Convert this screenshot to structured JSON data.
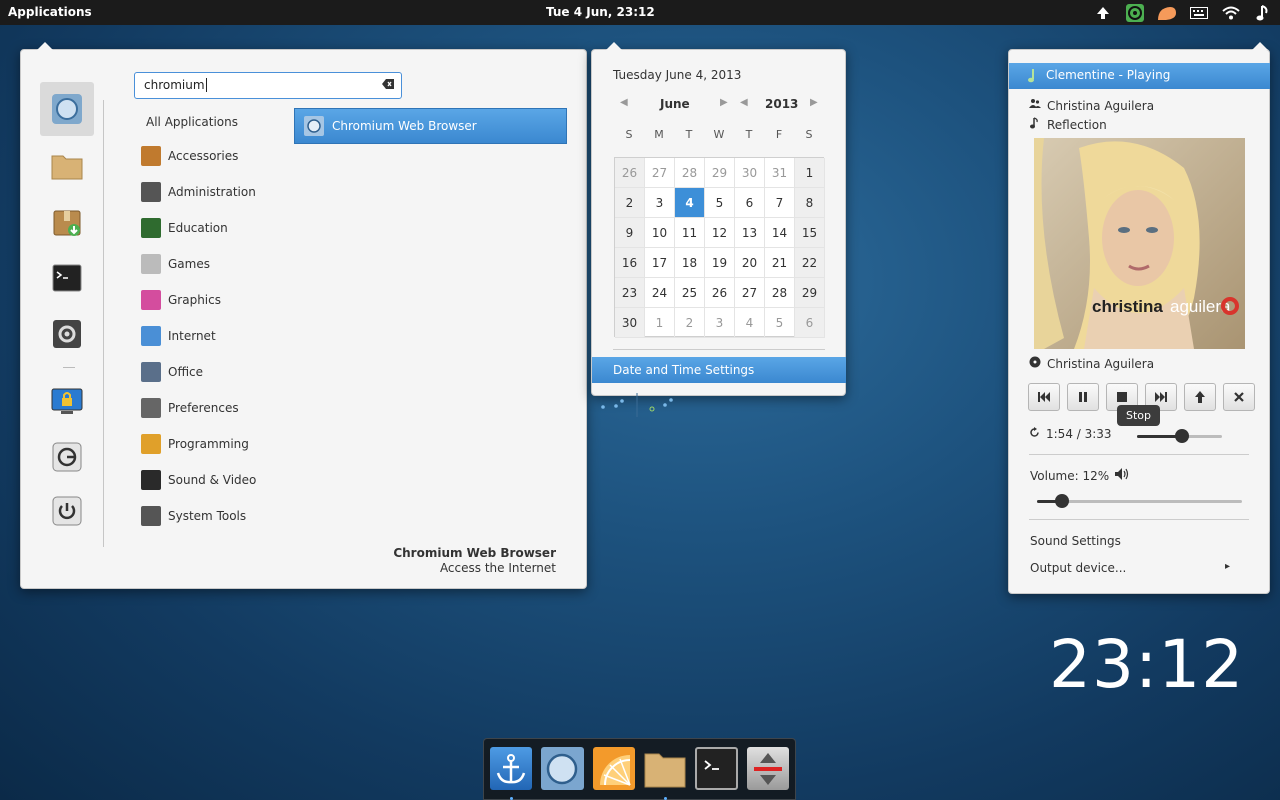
{
  "panel": {
    "applications_label": "Applications",
    "clock": "Tue  4 Jun, 23:12",
    "tray_icons": [
      "upload-icon",
      "clementine-icon",
      "power-plug-icon",
      "keyboard-icon",
      "wifi-icon",
      "sound-icon"
    ]
  },
  "appmenu": {
    "search_value": "chromium",
    "categories_header": "All Applications",
    "categories": [
      {
        "label": "Accessories",
        "icon": "calculator-icon",
        "color": "#c07a2e"
      },
      {
        "label": "Administration",
        "icon": "gear-icon",
        "color": "#555555"
      },
      {
        "label": "Education",
        "icon": "chalkboard-icon",
        "color": "#2f6b2f"
      },
      {
        "label": "Games",
        "icon": "gamepad-icon",
        "color": "#bbbbbb"
      },
      {
        "label": "Graphics",
        "icon": "palette-icon",
        "color": "#d44d9e"
      },
      {
        "label": "Internet",
        "icon": "globe-icon",
        "color": "#4a8fd6"
      },
      {
        "label": "Office",
        "icon": "chart-icon",
        "color": "#5a6f8a"
      },
      {
        "label": "Preferences",
        "icon": "sliders-icon",
        "color": "#666666"
      },
      {
        "label": "Programming",
        "icon": "construction-icon",
        "color": "#e0a02a"
      },
      {
        "label": "Sound & Video",
        "icon": "film-icon",
        "color": "#2a2a2a"
      },
      {
        "label": "System Tools",
        "icon": "tools-icon",
        "color": "#555555"
      }
    ],
    "result_label": "Chromium Web Browser",
    "desc_title": "Chromium Web Browser",
    "desc_subtitle": "Access the Internet"
  },
  "calendar": {
    "full_date": "Tuesday June  4, 2013",
    "month": "June",
    "year": "2013",
    "weekdays": [
      "S",
      "M",
      "T",
      "W",
      "T",
      "F",
      "S"
    ],
    "weeks": [
      [
        "26",
        "27",
        "28",
        "29",
        "30",
        "31",
        "1"
      ],
      [
        "2",
        "3",
        "4",
        "5",
        "6",
        "7",
        "8"
      ],
      [
        "9",
        "10",
        "11",
        "12",
        "13",
        "14",
        "15"
      ],
      [
        "16",
        "17",
        "18",
        "19",
        "20",
        "21",
        "22"
      ],
      [
        "23",
        "24",
        "25",
        "26",
        "27",
        "28",
        "29"
      ],
      [
        "30",
        "1",
        "2",
        "3",
        "4",
        "5",
        "6"
      ]
    ],
    "today": "4",
    "settings_label": "Date and Time Settings"
  },
  "sound": {
    "player_status": "Clementine - Playing",
    "artist": "Christina Aguilera",
    "track": "Reflection",
    "cover_text_1": "christina",
    "cover_text_2": "aguilera",
    "album": "Christina Aguilera",
    "tooltip": "Stop",
    "time": "1:54 / 3:33",
    "progress": 0.53,
    "volume_label": "Volume: 12%",
    "volume": 0.12,
    "sound_settings": "Sound Settings",
    "output_device": "Output device...",
    "output_arrow": "▸"
  },
  "desktop_clock": "23:12",
  "dock": {
    "items": [
      "anchor-icon",
      "chromium-icon",
      "clementine-icon",
      "folder-icon",
      "terminal-icon",
      "installer-icon"
    ]
  },
  "colors": {
    "accent": "#3d8fd8",
    "panel": "#1b1b1b"
  }
}
